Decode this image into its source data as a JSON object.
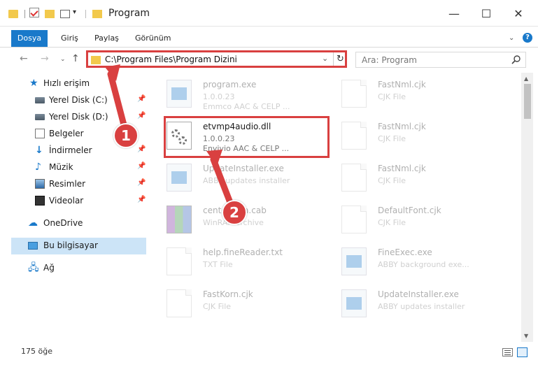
{
  "window": {
    "title": "Program",
    "minimize_glyph": "—",
    "maximize_glyph": "☐",
    "close_glyph": "✕"
  },
  "ribbon": {
    "tabs": [
      "Dosya",
      "Giriş",
      "Paylaş",
      "Görünüm"
    ],
    "help": "?"
  },
  "address_bar": {
    "path": "C:\\Program Files\\Program Dizini",
    "refresh_glyph": "↻",
    "dropdown_glyph": "⌄"
  },
  "search": {
    "placeholder": "Ara: Program"
  },
  "sidebar": {
    "quick_access": "Hızlı erişim",
    "items": [
      {
        "label": "Yerel Disk (C:)",
        "icon": "drive-icon",
        "pinned": true
      },
      {
        "label": "Yerel Disk (D:)",
        "icon": "drive-icon",
        "pinned": true
      },
      {
        "label": "Belgeler",
        "icon": "documents-icon",
        "pinned": true
      },
      {
        "label": "İndirmeler",
        "icon": "download-icon",
        "pinned": true
      },
      {
        "label": "Müzik",
        "icon": "music-icon",
        "pinned": true
      },
      {
        "label": "Resimler",
        "icon": "pictures-icon",
        "pinned": true
      },
      {
        "label": "Videolar",
        "icon": "videos-icon",
        "pinned": true
      }
    ],
    "onedrive": "OneDrive",
    "this_pc": "Bu bilgisayar",
    "network": "Ağ"
  },
  "files": [
    {
      "name": "program.exe",
      "meta1": "1.0.0.23",
      "meta2": "Emmco AAC & CELP ...",
      "icon": "exe-icon"
    },
    {
      "name": "etvmp4audio.dll",
      "meta1": "1.0.0.23",
      "meta2": "Envivio AAC & CELP ...",
      "icon": "dll-gear-icon"
    },
    {
      "name": "UpdateInstaller.exe",
      "meta1": "ABBY updates installer",
      "meta2": "",
      "icon": "exe-icon"
    },
    {
      "name": "centerdata.cab",
      "meta1": "WinRAR archive",
      "meta2": "",
      "icon": "rar-icon"
    },
    {
      "name": "help.fineReader.txt",
      "meta1": "TXT File",
      "meta2": "",
      "icon": "text-file-icon"
    },
    {
      "name": "FastKorn.cjk",
      "meta1": "CJK File",
      "meta2": "",
      "icon": "file-icon"
    },
    {
      "name": "FastNml.cjk",
      "meta1": "CJK File",
      "meta2": "",
      "icon": "file-icon"
    },
    {
      "name": "FastNml.cjk",
      "meta1": "CJK File",
      "meta2": "",
      "icon": "file-icon"
    },
    {
      "name": "FastNml.cjk",
      "meta1": "CJK File",
      "meta2": "",
      "icon": "file-icon"
    },
    {
      "name": "DefaultFont.cjk",
      "meta1": "CJK File",
      "meta2": "",
      "icon": "file-icon"
    },
    {
      "name": "FineExec.exe",
      "meta1": "ABBY background exe...",
      "meta2": "",
      "icon": "exe-icon"
    },
    {
      "name": "UpdateInstaller.exe",
      "meta1": "ABBY updates installer",
      "meta2": "",
      "icon": "exe-icon"
    }
  ],
  "status": {
    "item_count": "175 öğe"
  },
  "callouts": {
    "step1": "1",
    "step2": "2"
  },
  "colors": {
    "accent": "#1979ca",
    "callout_red": "#d94040",
    "selection": "#cce4f7"
  }
}
